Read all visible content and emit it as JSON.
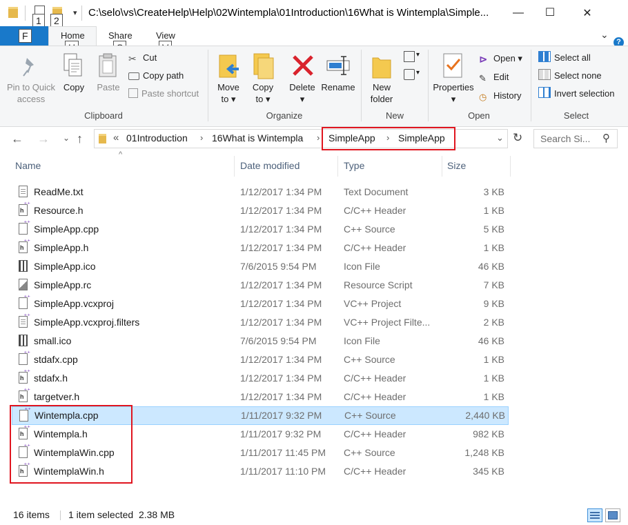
{
  "window": {
    "title": "C:\\selo\\vs\\CreateHelp\\Help\\02Wintempla\\01Introduction\\16What is Wintempla\\Simple...",
    "keytips_qat": [
      "1",
      "2"
    ],
    "minimize_glyph": "—",
    "maximize_glyph": "☐",
    "close_glyph": "✕"
  },
  "tabs": {
    "file": "F",
    "home": "Home",
    "share": "Share",
    "view": "View",
    "keytip_home": "H",
    "keytip_share": "S",
    "keytip_view": "V",
    "collapse_glyph": "⌄",
    "help_glyph": "?"
  },
  "ribbon": {
    "clipboard": {
      "pin_line1": "Pin to Quick",
      "pin_line2": "access",
      "copy": "Copy",
      "paste": "Paste",
      "cut": "Cut",
      "copy_path": "Copy path",
      "paste_shortcut": "Paste shortcut",
      "group": "Clipboard"
    },
    "organize": {
      "move_to_1": "Move",
      "move_to_2": "to ▾",
      "copy_to_1": "Copy",
      "copy_to_2": "to ▾",
      "delete": "Delete",
      "delete_arrow": "▾",
      "rename": "Rename",
      "group": "Organize"
    },
    "new": {
      "new_folder_1": "New",
      "new_folder_2": "folder",
      "group": "New"
    },
    "open": {
      "properties": "Properties",
      "properties_arrow": "▾",
      "open": "Open ▾",
      "edit": "Edit",
      "history": "History",
      "group": "Open"
    },
    "select": {
      "select_all": "Select all",
      "select_none": "Select none",
      "invert": "Invert selection",
      "group": "Select"
    }
  },
  "nav": {
    "back": "←",
    "forward": "→",
    "dropdown": "⌄",
    "up": "↑",
    "overflow": "«",
    "crumbs": [
      "01Introduction",
      "16What is Wintempla",
      "SimpleApp",
      "SimpleApp"
    ],
    "crumb_sep": "›",
    "address_dropdown": "⌄",
    "refresh": "↻",
    "search_placeholder": "Search Si...",
    "search_glyph": "⚲"
  },
  "columns": {
    "name": "Name",
    "date": "Date modified",
    "type": "Type",
    "size": "Size",
    "sort_glyph": "^"
  },
  "files": [
    {
      "name": "ReadMe.txt",
      "date": "1/12/2017 1:34 PM",
      "type": "Text Document",
      "size": "3 KB",
      "icon": "text-file-icon"
    },
    {
      "name": "Resource.h",
      "date": "1/12/2017 1:34 PM",
      "type": "C/C++ Header",
      "size": "1 KB",
      "icon": "header-file-icon"
    },
    {
      "name": "SimpleApp.cpp",
      "date": "1/12/2017 1:34 PM",
      "type": "C++ Source",
      "size": "5 KB",
      "icon": "cpp-file-icon"
    },
    {
      "name": "SimpleApp.h",
      "date": "1/12/2017 1:34 PM",
      "type": "C/C++ Header",
      "size": "1 KB",
      "icon": "header-file-icon"
    },
    {
      "name": "SimpleApp.ico",
      "date": "7/6/2015 9:54 PM",
      "type": "Icon File",
      "size": "46 KB",
      "icon": "ico-file-icon"
    },
    {
      "name": "SimpleApp.rc",
      "date": "1/12/2017 1:34 PM",
      "type": "Resource Script",
      "size": "7 KB",
      "icon": "rc-file-icon"
    },
    {
      "name": "SimpleApp.vcxproj",
      "date": "1/12/2017 1:34 PM",
      "type": "VC++ Project",
      "size": "9 KB",
      "icon": "vcxproj-file-icon"
    },
    {
      "name": "SimpleApp.vcxproj.filters",
      "date": "1/12/2017 1:34 PM",
      "type": "VC++ Project Filte...",
      "size": "2 KB",
      "icon": "filters-file-icon"
    },
    {
      "name": "small.ico",
      "date": "7/6/2015 9:54 PM",
      "type": "Icon File",
      "size": "46 KB",
      "icon": "ico-file-icon"
    },
    {
      "name": "stdafx.cpp",
      "date": "1/12/2017 1:34 PM",
      "type": "C++ Source",
      "size": "1 KB",
      "icon": "cpp-file-icon"
    },
    {
      "name": "stdafx.h",
      "date": "1/12/2017 1:34 PM",
      "type": "C/C++ Header",
      "size": "1 KB",
      "icon": "header-file-icon"
    },
    {
      "name": "targetver.h",
      "date": "1/12/2017 1:34 PM",
      "type": "C/C++ Header",
      "size": "1 KB",
      "icon": "header-file-icon"
    },
    {
      "name": "Wintempla.cpp",
      "date": "1/11/2017 9:32 PM",
      "type": "C++ Source",
      "size": "2,440 KB",
      "icon": "cpp-file-icon",
      "selected": true
    },
    {
      "name": "Wintempla.h",
      "date": "1/11/2017 9:32 PM",
      "type": "C/C++ Header",
      "size": "982 KB",
      "icon": "header-file-icon"
    },
    {
      "name": "WintemplaWin.cpp",
      "date": "1/11/2017 11:45 PM",
      "type": "C++ Source",
      "size": "1,248 KB",
      "icon": "cpp-file-icon"
    },
    {
      "name": "WintemplaWin.h",
      "date": "1/11/2017 11:10 PM",
      "type": "C/C++ Header",
      "size": "345 KB",
      "icon": "header-file-icon"
    }
  ],
  "status": {
    "count": "16 items",
    "selection": "1 item selected  2.38 MB"
  },
  "colors": {
    "accent": "#1979ca",
    "selection": "#cce8ff",
    "highlight_box": "#e0141e"
  }
}
